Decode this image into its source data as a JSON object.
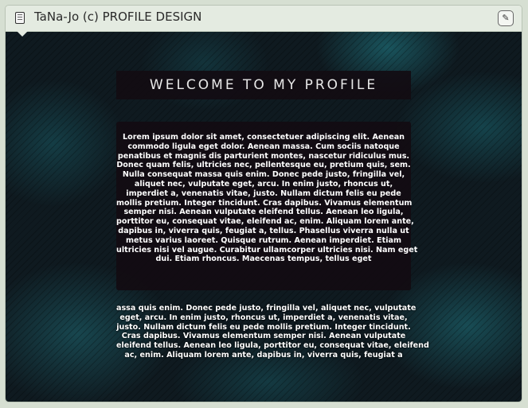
{
  "header": {
    "title": "TaNa-Jo (c) PROFILE DESIGN",
    "edit_icon": "pencil-icon",
    "doc_icon": "document-icon"
  },
  "welcome": "WELCOME TO MY PROFILE",
  "box_lines": [
    "Lorem ipsum dolor sit amet, consectetuer adipiscing elit. Aenean",
    "commodo ligula eget dolor. Aenean massa. Cum sociis natoque",
    "penatibus et magnis dis parturient montes, nascetur ridiculus mus.",
    "Donec quam felis, ultricies nec, pellentesque eu, pretium quis, sem.",
    "Nulla consequat massa quis enim. Donec pede justo, fringilla vel,",
    "aliquet nec, vulputate eget, arcu. In enim justo, rhoncus ut,",
    "imperdiet a, venenatis vitae, justo. Nullam dictum felis eu pede",
    "mollis pretium. Integer tincidunt. Cras dapibus. Vivamus elementum",
    "semper nisi. Aenean vulputate eleifend tellus. Aenean leo ligula,",
    "porttitor eu, consequat vitae, eleifend ac, enim. Aliquam lorem ante,",
    "dapibus in, viverra quis, feugiat a, tellus. Phasellus viverra nulla ut",
    "metus varius laoreet. Quisque rutrum. Aenean imperdiet. Etiam",
    "ultricies nisi vel augue. Curabitur ullamcorper ultricies nisi. Nam eget",
    "dui. Etiam rhoncus. Maecenas tempus, tellus eget"
  ],
  "lower_lines": [
    "assa quis enim. Donec pede justo, fringilla vel, aliquet nec, vulputate",
    "eget, arcu. In enim justo, rhoncus ut, imperdiet a, venenatis vitae,",
    "justo. Nullam dictum felis eu pede mollis pretium. Integer tincidunt.",
    "Cras dapibus. Vivamus elementum semper nisi. Aenean vulputate",
    "eleifend tellus. Aenean leo ligula, porttitor eu, consequat vitae, eleifend",
    "ac, enim. Aliquam lorem ante, dapibus in, viverra quis, feugiat a"
  ]
}
